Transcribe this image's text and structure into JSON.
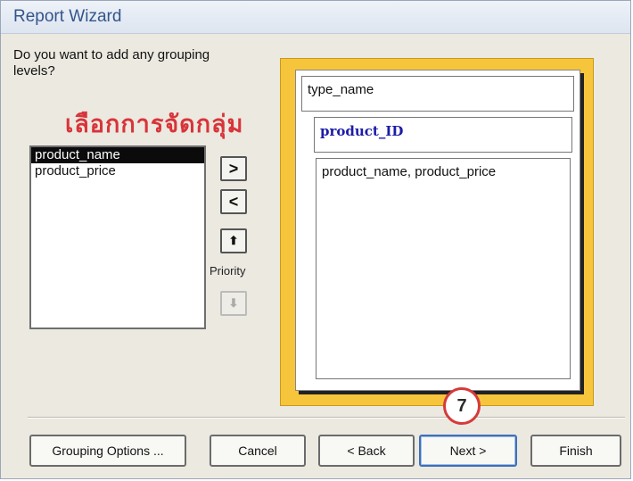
{
  "window": {
    "title": "Report Wizard"
  },
  "question": "Do you want to add any grouping levels?",
  "annotation": "เลือกการจัดกลุ่ม",
  "fields": {
    "items": [
      {
        "label": "product_name",
        "selected": true
      },
      {
        "label": "product_price",
        "selected": false
      }
    ]
  },
  "buttons": {
    "add": ">",
    "remove": "<",
    "priority_up": "⬆",
    "priority_down": "⬇",
    "priority_label": "Priority"
  },
  "preview": {
    "level1": "type_name",
    "level2": "product_ID",
    "detail": "product_name, product_price"
  },
  "callout": {
    "number": "7"
  },
  "footer": {
    "grouping_options": "Grouping Options ...",
    "cancel": "Cancel",
    "back": "< Back",
    "next": "Next >",
    "finish": "Finish"
  },
  "colors": {
    "title": "#33558c",
    "annotation": "#d8343a",
    "preview_border": "#f6c53c",
    "group_text": "#1c1ca8",
    "callout_ring": "#d63a3a"
  }
}
